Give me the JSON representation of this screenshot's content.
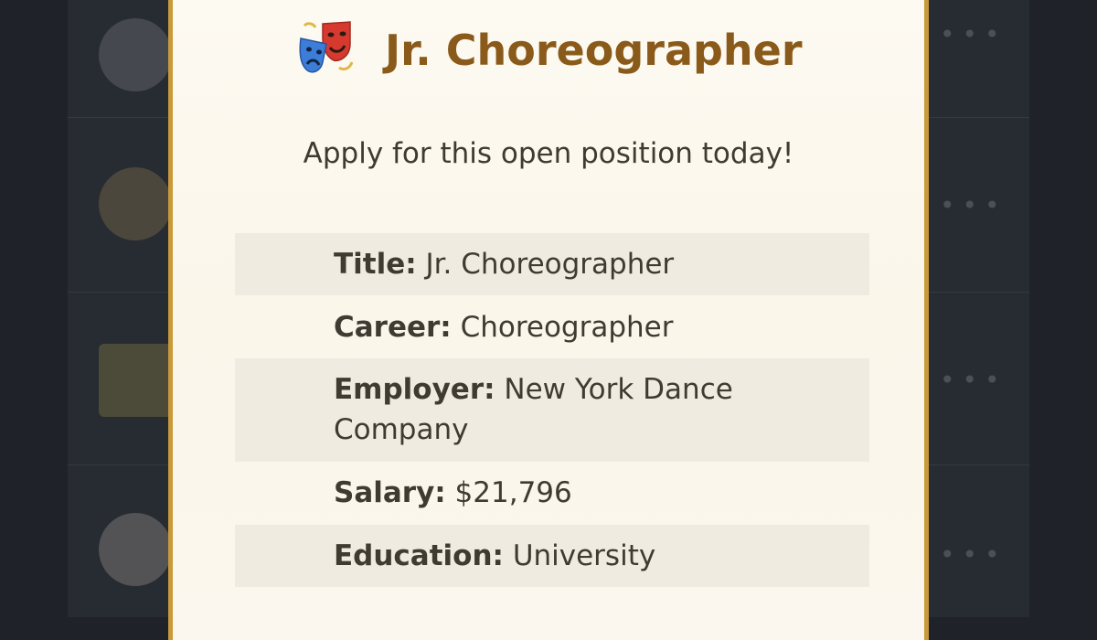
{
  "modal": {
    "icon": "theater-masks-icon",
    "title": "Jr. Choreographer",
    "subtitle": "Apply for this open position today!",
    "details": [
      {
        "label": "Title:",
        "value": "Jr. Choreographer"
      },
      {
        "label": "Career:",
        "value": "Choreographer"
      },
      {
        "label": "Employer:",
        "value": "New York Dance Company"
      },
      {
        "label": "Salary:",
        "value": "$21,796"
      },
      {
        "label": "Education:",
        "value": "University"
      }
    ]
  },
  "background_list": {
    "row_icons": [
      "statue-icon",
      "palette-icon",
      "barrier-icon",
      "clown-icon"
    ],
    "more_menu_icon": "ellipsis-icon"
  }
}
